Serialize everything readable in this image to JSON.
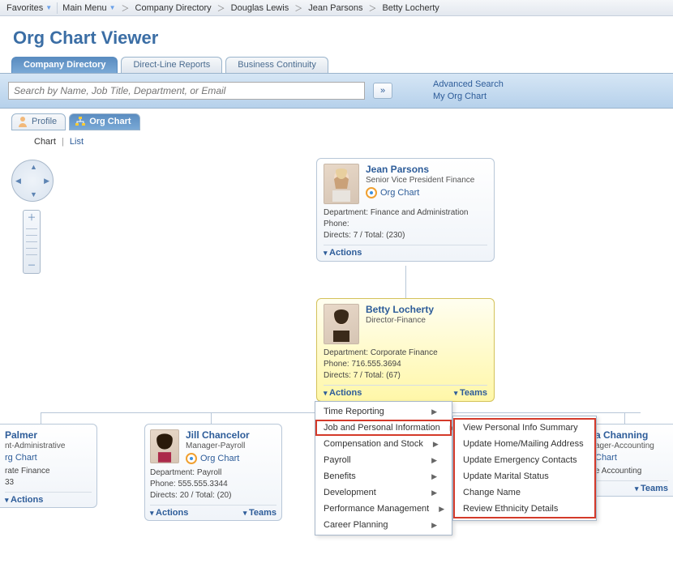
{
  "topnav": {
    "favorites": "Favorites",
    "mainmenu": "Main Menu",
    "crumbs": [
      "Company Directory",
      "Douglas Lewis",
      "Jean Parsons",
      "Betty Locherty"
    ]
  },
  "page_title": "Org Chart Viewer",
  "main_tabs": [
    "Company Directory",
    "Direct-Line Reports",
    "Business Continuity"
  ],
  "search": {
    "placeholder": "Search by Name, Job Title, Department, or Email",
    "advanced": "Advanced Search",
    "my_org": "My Org Chart"
  },
  "subtabs": {
    "profile": "Profile",
    "orgchart": "Org Chart"
  },
  "view_toggle": {
    "chart": "Chart",
    "list": "List"
  },
  "labels": {
    "actions": "Actions",
    "teams": "Teams",
    "orgchart_link": "Org Chart",
    "dept": "Department:",
    "phone": "Phone:",
    "directs": "Directs:",
    "total": "Total:"
  },
  "cards": {
    "parent": {
      "name": "Jean Parsons",
      "title": "Senior Vice President Finance",
      "dept": "Finance and Administration",
      "phone": "",
      "directs": "7",
      "total": "(230)"
    },
    "focus": {
      "name": "Betty Locherty",
      "title": "Director-Finance",
      "dept": "Corporate Finance",
      "phone": "716.555.3694",
      "directs": "7",
      "total": "(67)"
    },
    "children": [
      {
        "name": "Palmer",
        "title": "nt-Administrative",
        "orgchart": "rg Chart",
        "dept": "rate Finance",
        "phone": "33",
        "directs": "",
        "total": "",
        "footer_dept": "",
        "footer_phone": ""
      },
      {
        "name": "Jill Chancelor",
        "title": "Manager-Payroll",
        "dept": "Payroll",
        "phone": "555.555.3344",
        "directs": "20",
        "total": "(20)"
      },
      {
        "name": "a Channing",
        "title": "ager-Accounting",
        "orgchart": "Chart",
        "dept": "e Accounting",
        "phone": "",
        "directs": "",
        "total": ""
      }
    ]
  },
  "actions_menu": [
    "Time Reporting",
    "Job and Personal Information",
    "Compensation and Stock",
    "Payroll",
    "Benefits",
    "Development",
    "Performance Management",
    "Career Planning"
  ],
  "jpi_submenu": [
    "View Personal Info Summary",
    "Update Home/Mailing Address",
    "Update Emergency Contacts",
    "Update Marital Status",
    "Change Name",
    "Review Ethnicity Details"
  ]
}
